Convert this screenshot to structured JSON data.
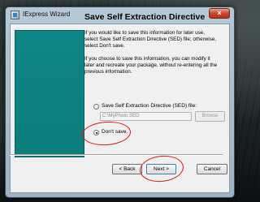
{
  "window": {
    "title": "IExpress Wizard",
    "close_glyph": "×"
  },
  "main": {
    "heading": "Save Self Extraction Directive",
    "paragraph1": "If you would like to save this information for later use, select Save Self Extraction Directive (SED) file; otherwise, select Don't save.",
    "paragraph2": "If you choose to save this information, you can modify it later and recreate your package, without re-entering all the previous information.",
    "options": [
      {
        "label": "Save Self Extraction Directive (SED) file:",
        "selected": false
      },
      {
        "label": "Don't save.",
        "selected": true
      }
    ],
    "sed_path": "C:\\MyPhoto.SED",
    "browse_label": "Browse"
  },
  "buttons": {
    "back": "< Back",
    "next": "Next >",
    "cancel": "Cancel"
  },
  "colors": {
    "side_panel": "#0c7d7d",
    "annotation": "#e0161a"
  },
  "icons": [
    "app-icon",
    "close-icon"
  ]
}
